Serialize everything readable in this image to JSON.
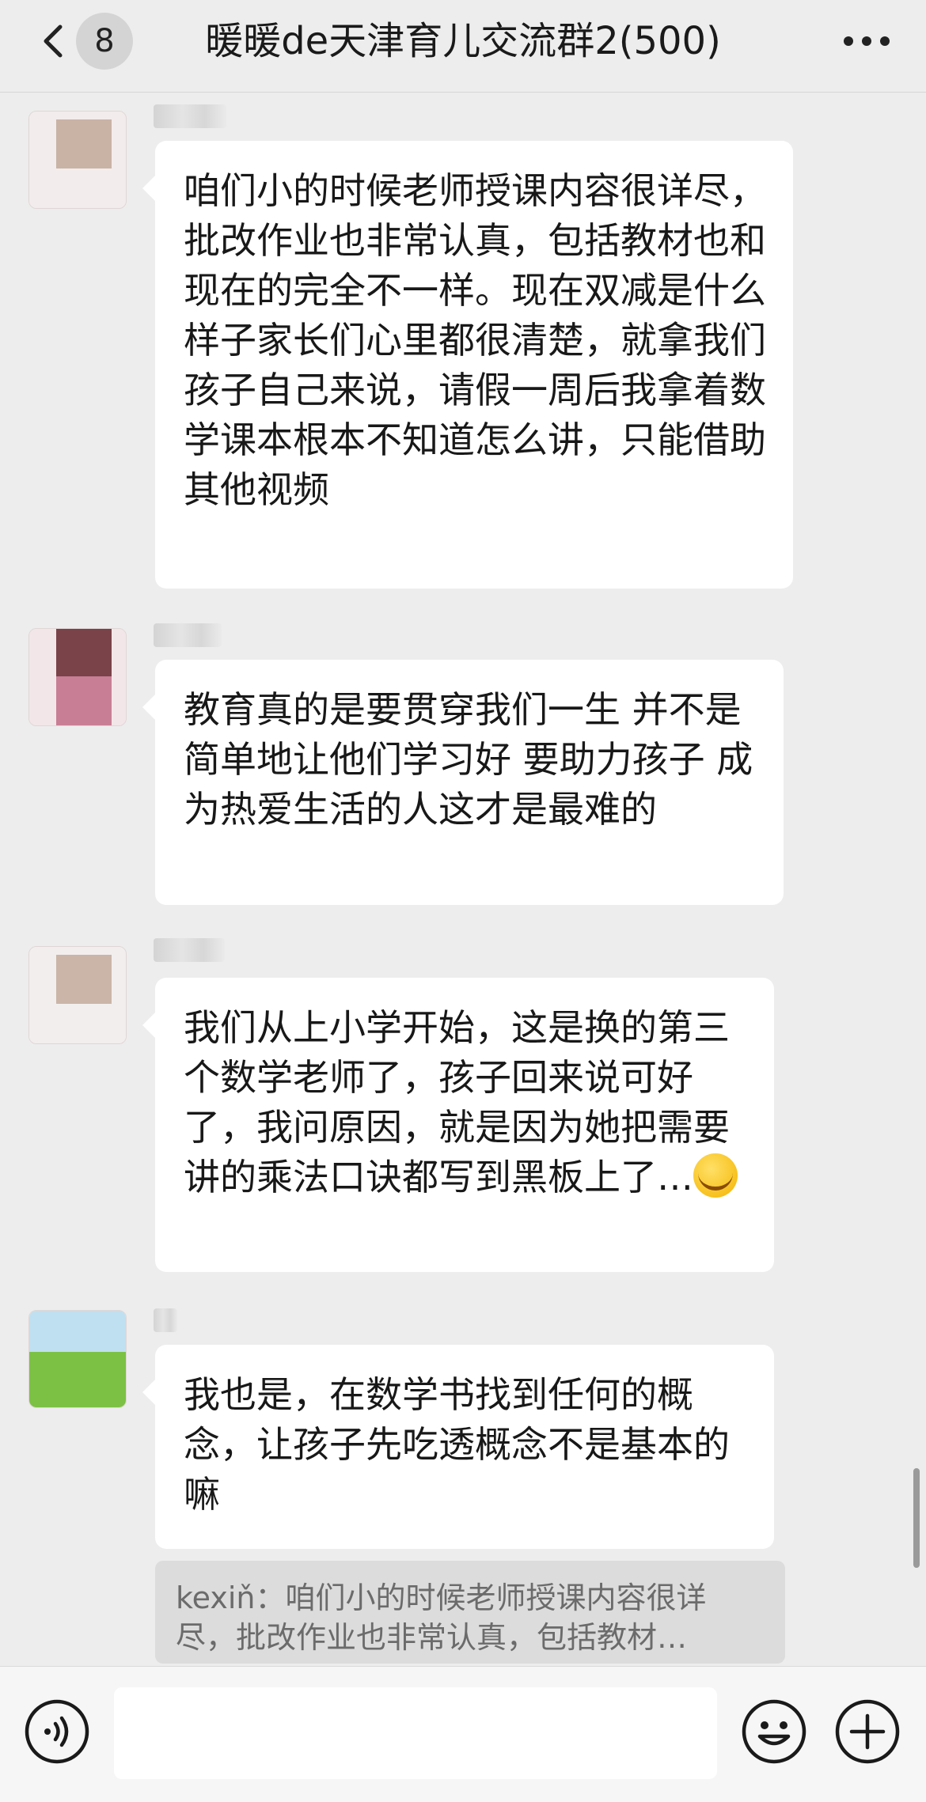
{
  "header": {
    "back_icon": "chevron-left-icon",
    "unread_count": "8",
    "title": "暖暖de天津育儿交流群2(500)",
    "more_icon": "more-dots-icon"
  },
  "messages": [
    {
      "avatar_colors": [
        "#c9b3a5",
        "#f3ecec"
      ],
      "text": "咱们小的时候老师授课内容很详尽，批改作业也非常认真，包括教材也和现在的完全不一样。现在双减是什么样子家长们心里都很清楚，就拿我们孩子自己来说，请假一周后我拿着数学课本根本不知道怎么讲，只能借助其他视频"
    },
    {
      "avatar_colors": [
        "#7a4249",
        "#c87f96"
      ],
      "text": "教育真的是要贯穿我们一生 并不是简单地让他们学习好 要助力孩子 成为热爱生活的人这才是最难的"
    },
    {
      "avatar_colors": [
        "#cbb5a8",
        "#f2eeee"
      ],
      "text": "我们从上小学开始，这是换的第三个数学老师了，孩子回来说可好了，我问原因，就是因为她把需要讲的乘法口诀都写到黑板上了…",
      "emoji": "face-with-tears-of-joy-emoji"
    },
    {
      "avatar_colors": [
        "#bfe0f0",
        "#7cc144"
      ],
      "text": "我也是，在数学书找到任何的概念，让孩子先吃透概念不是基本的嘛"
    }
  ],
  "quote": {
    "text": "kexiň：咱们小的时候老师授课内容很详尽，批改作业也非常认真，包括教材…"
  },
  "input_bar": {
    "voice_icon": "voice-icon",
    "input_value": "",
    "emoji_icon": "smiley-icon",
    "add_icon": "plus-circle-icon"
  }
}
